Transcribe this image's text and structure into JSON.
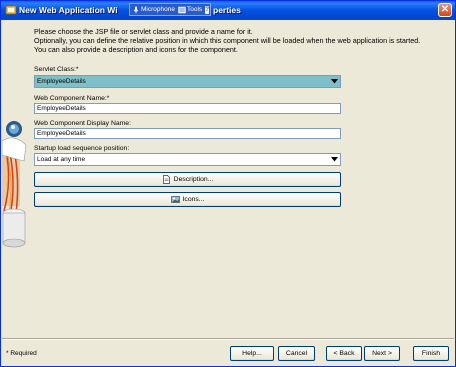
{
  "window": {
    "title_left": "New Web Application Wi",
    "title_right": "perties",
    "close_glyph": "✕"
  },
  "overlay_toolbar": {
    "microphone_label": "Microphone",
    "tools_label": "Tools",
    "help_glyph": "?"
  },
  "description": {
    "line1": "Please choose the JSP file or servlet class and provide a name for it.",
    "line2": "Optionally, you can define the relative position in which this component will be loaded when the web application is started.",
    "line3": "You can also provide a description and icons for the component."
  },
  "form": {
    "servlet_class_label": "Servlet Class:*",
    "servlet_class_value": "EmployeeDetails",
    "component_name_label": "Web Component Name:*",
    "component_name_value": "EmployeeDetails",
    "display_name_label": "Web Component Display Name:",
    "display_name_value": "EmployeeDetails",
    "startup_label": "Startup load sequence position:",
    "startup_value": "Load at any time",
    "description_button": "Description...",
    "icons_button": "Icons..."
  },
  "footer": {
    "required_note": "* Required",
    "help": "Help...",
    "cancel": "Cancel",
    "back": "< Back",
    "next": "Next >",
    "finish": "Finish"
  },
  "colors": {
    "title_bar": "#0554e3",
    "selected_combo": "#7fbfc8",
    "dialog_bg": "#ece9d8"
  }
}
